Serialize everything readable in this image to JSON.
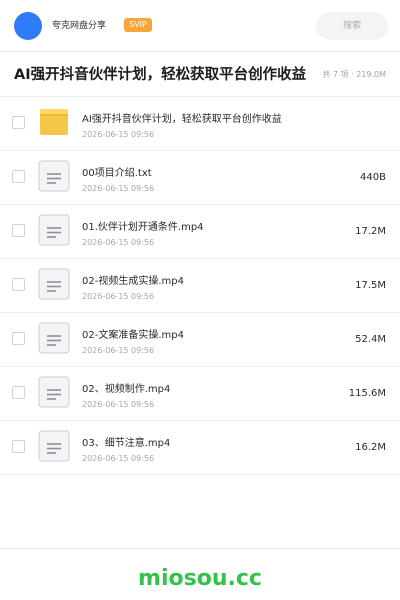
{
  "header": {
    "user_name": "夸克网盘分享",
    "badge": "SVIP",
    "search_placeholder": "搜索",
    "avatar_color": "#2f7cf6"
  },
  "share": {
    "title": "AI强开抖音伙伴计划，轻松获取平台创作收益",
    "meta": "共 7 项 · 219.0M"
  },
  "files": [
    {
      "icon": "folder-icon",
      "name": "AI强开抖音伙伴计划，轻松获取平台创作收益",
      "date": "2026-06-15 09:56",
      "size": ""
    },
    {
      "icon": "document-icon",
      "name": "00项目介绍.txt",
      "date": "2026-06-15 09:56",
      "size": "440B"
    },
    {
      "icon": "document-icon",
      "name": "01.伙伴计划开通条件.mp4",
      "date": "2026-06-15 09:56",
      "size": "17.2M"
    },
    {
      "icon": "document-icon",
      "name": "02-视频生成实操.mp4",
      "date": "2026-06-15 09:56",
      "size": "17.5M"
    },
    {
      "icon": "document-icon",
      "name": "02-文案准备实操.mp4",
      "date": "2026-06-15 09:56",
      "size": "52.4M"
    },
    {
      "icon": "document-icon",
      "name": "02、视频制作.mp4",
      "date": "2026-06-15 09:56",
      "size": "115.6M"
    },
    {
      "icon": "document-icon",
      "name": "03、细节注意.mp4",
      "date": "2026-06-15 09:56",
      "size": "16.2M"
    }
  ],
  "footer": {
    "brand": "miosou.cc",
    "brand_color": "#35c24a"
  }
}
